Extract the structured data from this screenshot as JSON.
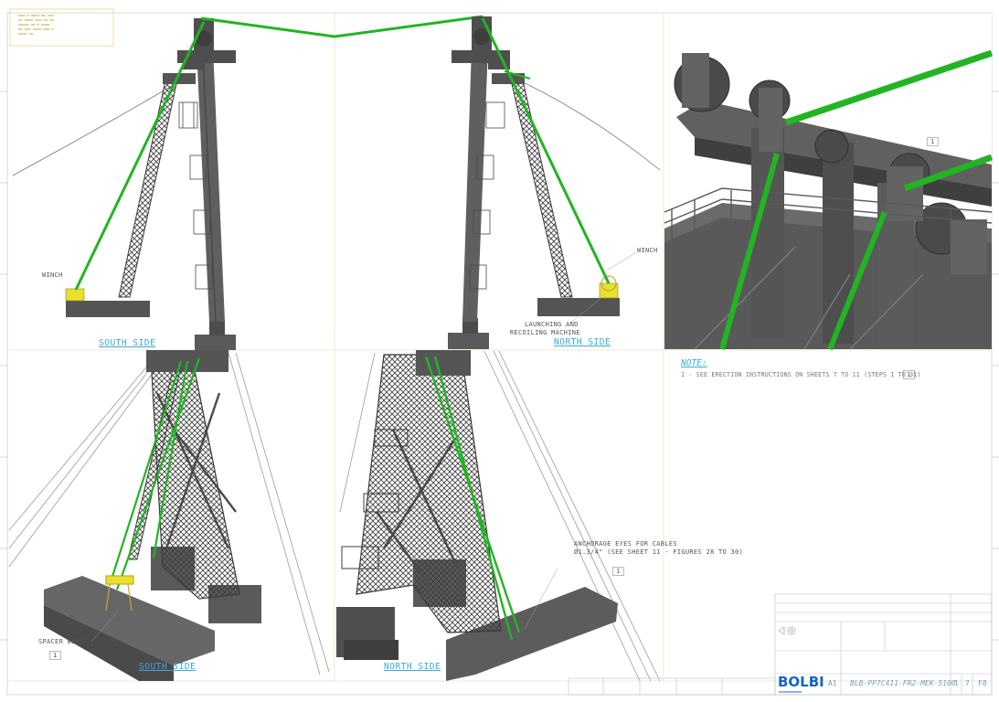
{
  "labels": {
    "winch_left": "WINCH",
    "winch_right": "WINCH",
    "launching": "LAUNCHING AND",
    "recoiling": "RECOILING MACHINE",
    "spacer": "SPACER BEAM",
    "anchorage_1": "ANCHORAGE EYES FOR CABLES",
    "anchorage_2": "Ø1.3/4\" (SEE SHEET 11 - FIGURES 28 TO 30)",
    "bubble": "1"
  },
  "views": {
    "south_top": "SOUTH SIDE",
    "north_top": "NORTH SIDE",
    "south_bottom": "SOUTH SIDE",
    "north_bottom": "NORTH SIDE"
  },
  "note": {
    "title": "NOTE:",
    "line": "1 - SEE ERECTION INSTRUCTIONS ON SHEETS 7 TO 11 (STEPS 1 TO 31)"
  },
  "title_block": {
    "brand": "BOLBI",
    "size": "A1",
    "drawing_no": "BLB-PP7C411-FR2-MEK-5100",
    "sheet": "1",
    "of": "7",
    "rev": "F8"
  },
  "colors": {
    "green_cable": "#22b422",
    "steel": "#5a5a5a",
    "winch": "#e8e030",
    "view_label": "#3aa9d8",
    "brand": "#1565c0"
  }
}
